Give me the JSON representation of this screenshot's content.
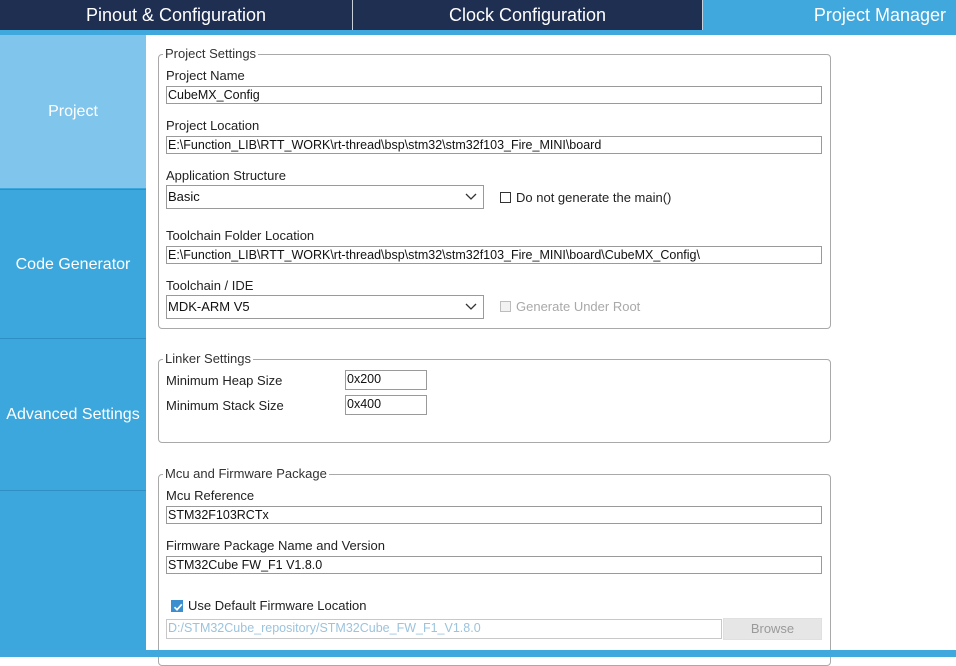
{
  "tabs": [
    {
      "label": "Pinout & Configuration"
    },
    {
      "label": "Clock Configuration"
    },
    {
      "label": "Project Manager",
      "active": true
    }
  ],
  "sidebar": {
    "items": [
      {
        "label": "Project",
        "active": true
      },
      {
        "label": "Code Generator"
      },
      {
        "label": "Advanced Settings"
      }
    ]
  },
  "project_settings": {
    "legend": "Project Settings",
    "project_name_label": "Project Name",
    "project_name": "CubeMX_Config",
    "project_location_label": "Project Location",
    "project_location": "E:\\Function_LIB\\RTT_WORK\\rt-thread\\bsp\\stm32\\stm32f103_Fire_MINI\\board",
    "app_structure_label": "Application Structure",
    "app_structure_value": "Basic",
    "no_main_label": "Do not generate the main()",
    "no_main_checked": false,
    "toolchain_folder_label": "Toolchain Folder Location",
    "toolchain_folder": "E:\\Function_LIB\\RTT_WORK\\rt-thread\\bsp\\stm32\\stm32f103_Fire_MINI\\board\\CubeMX_Config\\",
    "toolchain_label": "Toolchain / IDE",
    "toolchain_value": "MDK-ARM V5",
    "gen_under_root_label": "Generate Under Root",
    "gen_under_root_checked": false
  },
  "linker_settings": {
    "legend": "Linker Settings",
    "heap_label": "Minimum Heap Size",
    "heap_value": "0x200",
    "stack_label": "Minimum Stack Size",
    "stack_value": "0x400"
  },
  "mcu_package": {
    "legend": "Mcu and Firmware Package",
    "mcu_ref_label": "Mcu Reference",
    "mcu_ref": "STM32F103RCTx",
    "fw_label": "Firmware Package Name and Version",
    "fw_value": "STM32Cube FW_F1 V1.8.0",
    "use_default_label": "Use Default Firmware Location",
    "use_default_checked": true,
    "fw_location": "D:/STM32Cube_repository/STM32Cube_FW_F1_V1.8.0",
    "browse_label": "Browse"
  },
  "colors": {
    "tabbar": "#1f2f52",
    "accent": "#41a8de",
    "sidebar": "#3ca7dc",
    "sidebar_active": "#80c5eb"
  },
  "icons": {
    "dropdown": "chevron-down-icon",
    "check": "checkmark-icon"
  }
}
